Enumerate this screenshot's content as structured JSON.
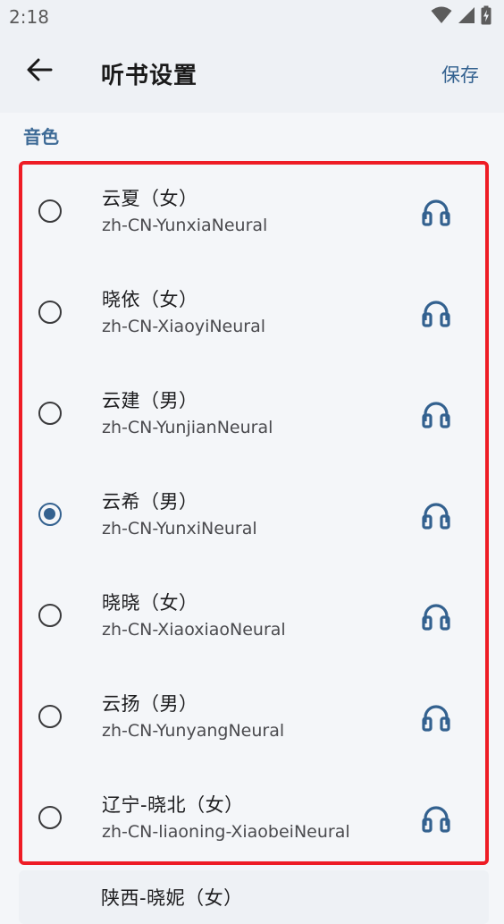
{
  "status_bar": {
    "time": "2:18",
    "icons": [
      "wifi-icon",
      "cellular-signal-icon",
      "battery-charging-icon"
    ]
  },
  "app_bar": {
    "back_icon": "arrow-left-icon",
    "title": "听书设置",
    "save_label": "保存"
  },
  "section": {
    "title": "音色"
  },
  "voices": [
    {
      "name": "云夏（女）",
      "id": "zh-CN-YunxiaNeural",
      "selected": false,
      "icon": "headphones-icon"
    },
    {
      "name": "晓依（女）",
      "id": "zh-CN-XiaoyiNeural",
      "selected": false,
      "icon": "headphones-icon"
    },
    {
      "name": "云建（男）",
      "id": "zh-CN-YunjianNeural",
      "selected": false,
      "icon": "headphones-icon"
    },
    {
      "name": "云希（男）",
      "id": "zh-CN-YunxiNeural",
      "selected": true,
      "icon": "headphones-icon"
    },
    {
      "name": "晓晓（女）",
      "id": "zh-CN-XiaoxiaoNeural",
      "selected": false,
      "icon": "headphones-icon"
    },
    {
      "name": "云扬（男）",
      "id": "zh-CN-YunyangNeural",
      "selected": false,
      "icon": "headphones-icon"
    },
    {
      "name": "辽宁-晓北（女）",
      "id": "zh-CN-liaoning-XiaobeiNeural",
      "selected": false,
      "icon": "headphones-icon"
    }
  ],
  "next_voice_partial": {
    "name": "陕西-晓妮（女）"
  },
  "colors": {
    "accent": "#33618f",
    "highlight_border": "#ee1c25",
    "background": "#f4f6f9",
    "app_bar_background": "#eef1f5"
  }
}
